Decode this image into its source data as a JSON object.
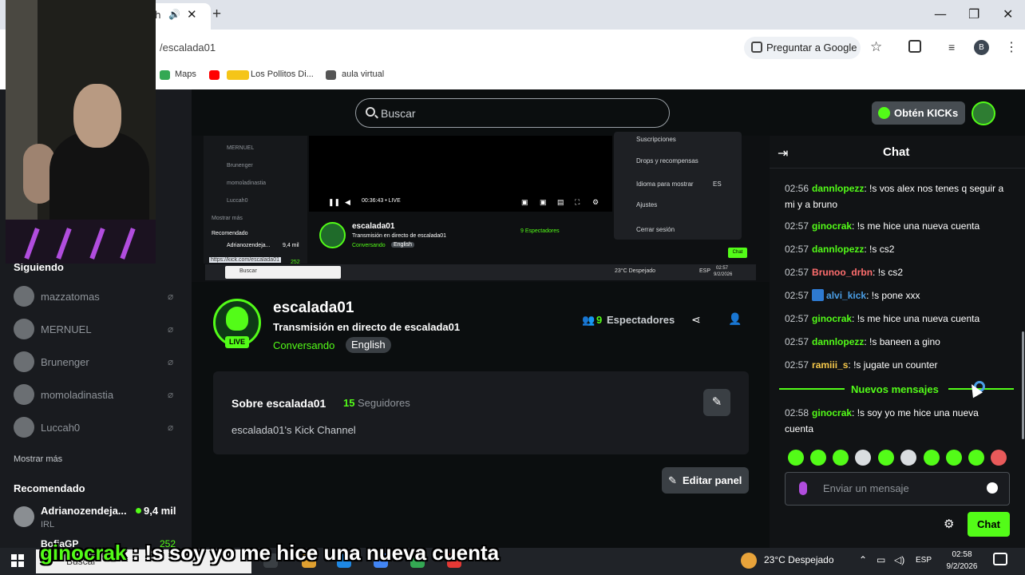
{
  "browser": {
    "tab_fragment": "h",
    "address": "/escalada01",
    "ask_google_label": "Preguntar a Google",
    "profile_initial": "B",
    "bookmarks": [
      "Maps",
      "Los Pollitos Di...",
      "aula virtual"
    ]
  },
  "header": {
    "search_placeholder": "Buscar",
    "kicks_label": "Obtén KICKs"
  },
  "sidebar": {
    "following_title": "Siguiendo",
    "following": [
      {
        "name": "mazzatomas"
      },
      {
        "name": "MERNUEL"
      },
      {
        "name": "Brunenger"
      },
      {
        "name": "momoladinastia"
      },
      {
        "name": "Luccah0"
      }
    ],
    "show_more": "Mostrar más",
    "recommended_title": "Recomendado",
    "recommended": [
      {
        "name": "Adrianozendeja...",
        "category": "IRL",
        "viewers": "9,4 mil"
      },
      {
        "name": "BofiaGP",
        "viewers": "252"
      }
    ]
  },
  "video_capture": {
    "sidebar_items": [
      "MERNUEL",
      "Brunenger",
      "momoladinastia",
      "Luccah0"
    ],
    "show_more": "Mostrar más",
    "recommended": "Recomendado",
    "rec_name": "Adrianozendeja...",
    "rec_viewers": "9,4 mil",
    "rec_viewers2": "252",
    "status_url": "https://kick.com/escalada01",
    "menu": [
      "Suscripciones",
      "Drops y recompensas",
      "Idioma para mostrar",
      "Ajustes",
      "Cerrar sesión"
    ],
    "menu_lang_value": "ES",
    "player_time": "00:36:43",
    "player_live": "LIVE",
    "channel": "escalada01",
    "title": "Transmisión en directo de escalada01",
    "category": "Conversando",
    "language": "English",
    "viewers": "9 Espectadores",
    "chat_button": "Chat",
    "search": "Buscar",
    "weather": "23°C Despejado",
    "lang": "ESP",
    "clock_time": "02:57",
    "clock_date": "9/2/2026"
  },
  "channel": {
    "name": "escalada01",
    "live_badge": "LIVE",
    "title": "Transmisión en directo de escalada01",
    "category": "Conversando",
    "language": "English",
    "viewers_count": "9",
    "viewers_label": "Espectadores"
  },
  "about": {
    "title": "Sobre escalada01",
    "followers_count": "15",
    "followers_label": "Seguidores",
    "description": "escalada01's Kick Channel",
    "edit_panel": "Editar panel"
  },
  "chat": {
    "title": "Chat",
    "messages": [
      {
        "time": "02:56",
        "user": "dannlopezz",
        "color": "#53fc18",
        "text": "!s vos alex nos tenes q seguir a mi y a bruno"
      },
      {
        "time": "02:57",
        "user": "ginocrak",
        "color": "#53fc18",
        "text": "!s me hice una nueva cuenta"
      },
      {
        "time": "02:57",
        "user": "dannlopezz",
        "color": "#53fc18",
        "text": "!s cs2"
      },
      {
        "time": "02:57",
        "user": "Brunoo_drbn",
        "color": "#ff6e6e",
        "text": "!s cs2"
      },
      {
        "time": "02:57",
        "user": "alvi_kick",
        "color": "#4a9ee6",
        "text": "!s pone xxx"
      },
      {
        "time": "02:57",
        "user": "ginocrak",
        "color": "#53fc18",
        "text": "!s me hice una nueva cuenta"
      },
      {
        "time": "02:57",
        "user": "dannlopezz",
        "color": "#53fc18",
        "text": "!s baneen a gino"
      },
      {
        "time": "02:57",
        "user": "ramiii_s",
        "color": "#f7c94b",
        "text": "!s jugate un counter"
      }
    ],
    "new_messages_label": "Nuevos mensajes",
    "new_message": {
      "time": "02:58",
      "user": "ginocrak",
      "color": "#53fc18",
      "text": "!s soy yo me hice una nueva cuenta"
    },
    "input_placeholder": "Enviar un mensaje",
    "send_label": "Chat"
  },
  "taskbar": {
    "search": "Buscar",
    "weather": "23°C  Despejado",
    "lang": "ESP",
    "time": "02:58",
    "date": "9/2/2026"
  },
  "subtitle": {
    "user": "ginocrak",
    "text": " : !s soy yo me hice una nueva cuenta"
  },
  "colors": {
    "accent": "#53fc18",
    "background": "#0b0e0f",
    "panel": "#191b1f"
  }
}
